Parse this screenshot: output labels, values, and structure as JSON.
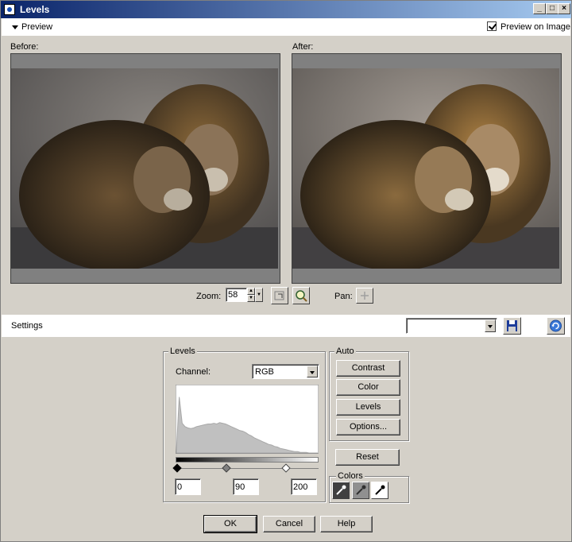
{
  "window": {
    "title": "Levels"
  },
  "preview": {
    "header_label": "Preview",
    "preview_on_image_label": "Preview on Image",
    "before_label": "Before:",
    "after_label": "After:"
  },
  "zoom": {
    "label": "Zoom:",
    "value": "58",
    "pan_label": "Pan:"
  },
  "settings": {
    "label": "Settings",
    "preset_value": ""
  },
  "levels": {
    "group_title": "Levels",
    "channel_label": "Channel:",
    "channel_value": "RGB",
    "input_black": "0",
    "input_gamma": "90",
    "input_white": "200",
    "histogram": [
      0.02,
      0.85,
      0.45,
      0.4,
      0.38,
      0.37,
      0.38,
      0.4,
      0.41,
      0.42,
      0.43,
      0.44,
      0.44,
      0.45,
      0.44,
      0.46,
      0.45,
      0.44,
      0.42,
      0.4,
      0.38,
      0.36,
      0.34,
      0.33,
      0.31,
      0.28,
      0.26,
      0.23,
      0.21,
      0.19,
      0.17,
      0.15,
      0.13,
      0.12,
      0.1,
      0.09,
      0.07,
      0.06,
      0.05,
      0.04,
      0.03,
      0.02,
      0.02,
      0.01,
      0.01,
      0.01,
      0.0,
      0.0,
      0.0,
      0.0
    ]
  },
  "auto": {
    "group_title": "Auto",
    "contrast": "Contrast",
    "color": "Color",
    "levels": "Levels",
    "options": "Options...",
    "reset": "Reset"
  },
  "colors": {
    "group_title": "Colors"
  },
  "footer": {
    "ok": "OK",
    "cancel": "Cancel",
    "help": "Help"
  }
}
